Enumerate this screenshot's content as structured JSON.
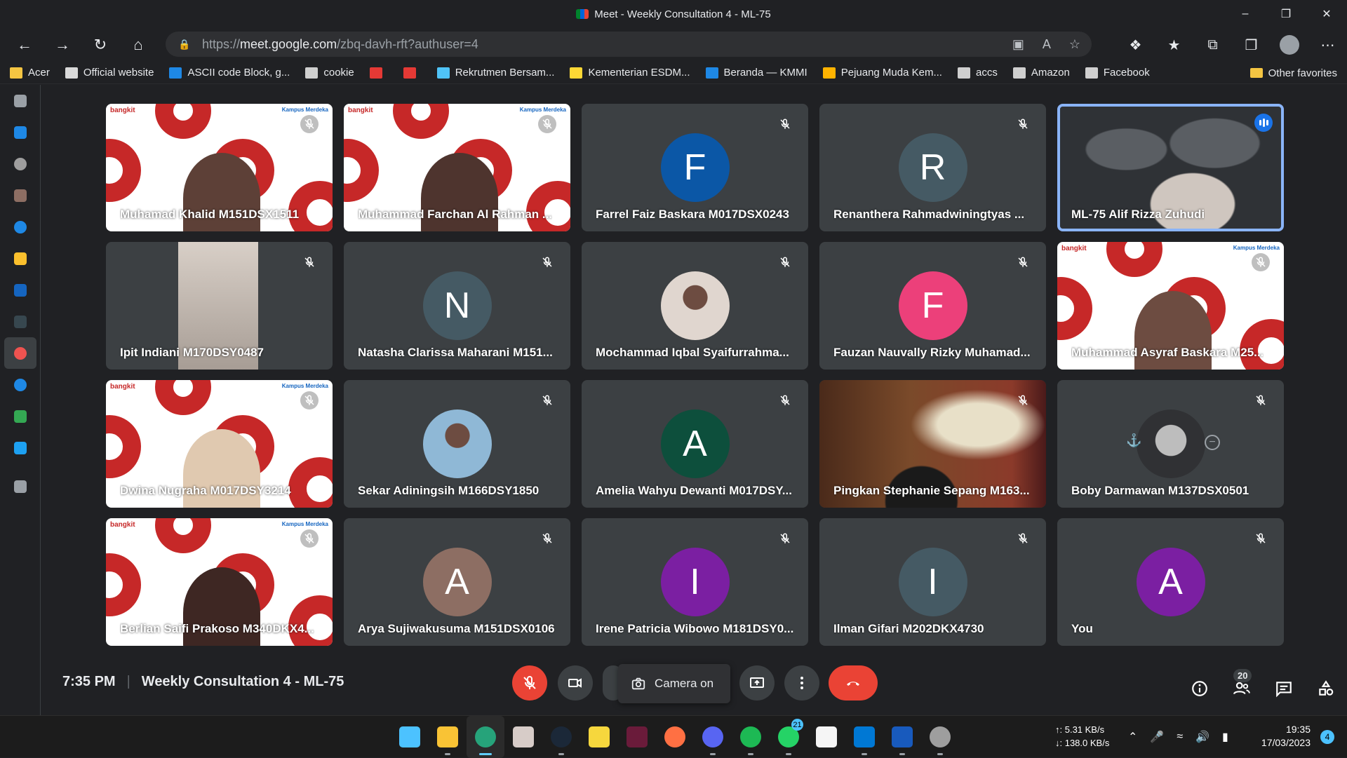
{
  "window": {
    "title": "Meet - Weekly Consultation 4 - ML-75"
  },
  "browser": {
    "url_prefix": "https://",
    "url_host": "meet.google.com",
    "url_path": "/zbq-davh-rft?authuser=4"
  },
  "favorites": [
    {
      "label": "Acer",
      "color": "#f4c542"
    },
    {
      "label": "Official website",
      "color": "#d9d9d9"
    },
    {
      "label": "ASCII code Block, g...",
      "color": "#1e88e5"
    },
    {
      "label": "cookie",
      "color": "#cfcfcf"
    },
    {
      "label": "",
      "color": "#e53935"
    },
    {
      "label": "",
      "color": "#e53935"
    },
    {
      "label": "Rekrutmen Bersam...",
      "color": "#4fc3f7"
    },
    {
      "label": "Kementerian ESDM...",
      "color": "#fdd835"
    },
    {
      "label": "Beranda — KMMI",
      "color": "#1e88e5"
    },
    {
      "label": "Pejuang Muda Kem...",
      "color": "#ffb300"
    },
    {
      "label": "accs",
      "color": "#cfcfcf"
    },
    {
      "label": "Amazon",
      "color": "#cfcfcf"
    },
    {
      "label": "Facebook",
      "color": "#cfcfcf"
    }
  ],
  "favorites_other": "Other favorites",
  "sidebar": [
    {
      "icon": "tabs-icon",
      "color": "#9aa0a6"
    },
    {
      "icon": "calendar-icon",
      "color": "#1e88e5"
    },
    {
      "icon": "chrome-icon",
      "color": "#9e9e9e"
    },
    {
      "icon": "image-app-icon",
      "color": "#8d6e63"
    },
    {
      "icon": "c-app-icon",
      "color": "#1e88e5"
    },
    {
      "icon": "emblem-icon",
      "color": "#fbc02d"
    },
    {
      "icon": "line-icon",
      "color": "#1565c0"
    },
    {
      "icon": "shield-app-icon",
      "color": "#37474f"
    },
    {
      "icon": "record-icon",
      "color": "#ef5350"
    },
    {
      "icon": "c-app-icon-2",
      "color": "#1e88e5"
    },
    {
      "icon": "drive-icon",
      "color": "#34a853"
    },
    {
      "icon": "twitter-icon",
      "color": "#1da1f2"
    },
    {
      "icon": "add-icon",
      "color": "#9aa0a6"
    }
  ],
  "participants": [
    {
      "name": "Muhamad Khalid M151DSX1511",
      "type": "bangkit",
      "skin": "#5d4037"
    },
    {
      "name": "Muhammad Farchan Al Rahman ...",
      "type": "bangkit",
      "skin": "#4e342e"
    },
    {
      "name": "Farrel Faiz Baskara M017DSX0243",
      "type": "letter",
      "letter": "F",
      "color": "#0b57a6"
    },
    {
      "name": "Renanthera Rahmadwiningtyas ...",
      "type": "letter",
      "letter": "R",
      "color": "#455a64"
    },
    {
      "name": "ML-75 Alif Rizza Zuhudi",
      "type": "worldmap",
      "speaking": true
    },
    {
      "name": "Ipit Indiani M170DSY0487",
      "type": "portrait"
    },
    {
      "name": "Natasha Clarissa Maharani M151...",
      "type": "letter",
      "letter": "N",
      "color": "#455a64"
    },
    {
      "name": "Mochammad Iqbal Syaifurrahma...",
      "type": "photo",
      "color": "#e0d6cf"
    },
    {
      "name": "Fauzan Nauvally Rizky Muhamad...",
      "type": "letter",
      "letter": "F",
      "color": "#ec407a"
    },
    {
      "name": "Muhammad Asyraf Baskara M25...",
      "type": "bangkit",
      "skin": "#6d4c41"
    },
    {
      "name": "Dwina Nugraha M017DSY3214",
      "type": "bangkit",
      "skin": "#e0c9b0"
    },
    {
      "name": "Sekar Adiningsih M166DSY1850",
      "type": "photo",
      "color": "#8fb8d6"
    },
    {
      "name": "Amelia Wahyu Dewanti M017DSY...",
      "type": "letter",
      "letter": "A",
      "color": "#0d4f3c"
    },
    {
      "name": "Pingkan Stephanie Sepang M163...",
      "type": "library"
    },
    {
      "name": "Boby Darmawan M137DSX0501",
      "type": "pinned"
    },
    {
      "name": "Berlian Saifi Prakoso M340DKX4...",
      "type": "bangkit",
      "skin": "#3e2723"
    },
    {
      "name": "Arya Sujiwakusuma M151DSX0106",
      "type": "letter",
      "letter": "A",
      "color": "#8d6e63"
    },
    {
      "name": "Irene Patricia Wibowo M181DSY0...",
      "type": "letter",
      "letter": "I",
      "color": "#7b1fa2"
    },
    {
      "name": "Ilman Gifari M202DKX4730",
      "type": "letter",
      "letter": "I",
      "color": "#455a64"
    },
    {
      "name": "You",
      "type": "letter",
      "letter": "A",
      "color": "#7b1fa2"
    }
  ],
  "meeting": {
    "time": "7:35 PM",
    "title": "Weekly Consultation 4 - ML-75",
    "camera_tooltip": "Camera on",
    "people_count": "20"
  },
  "taskbar": {
    "apps": [
      {
        "icon": "windows-start-icon",
        "color": "#4cc2ff",
        "active": false
      },
      {
        "icon": "file-explorer-icon",
        "color": "#f9c335",
        "active": false
      },
      {
        "icon": "edge-browser-icon",
        "color": "#26a37a",
        "active": true
      },
      {
        "icon": "photo-app-icon",
        "color": "#d7ccc8",
        "active": false
      },
      {
        "icon": "steam-icon",
        "color": "#1b2838",
        "active": false
      },
      {
        "icon": "sticky-notes-icon",
        "color": "#f6d73d",
        "active": false
      },
      {
        "icon": "media-app-icon",
        "color": "#6a1b3a",
        "active": false
      },
      {
        "icon": "search-app-icon",
        "color": "#ff7043",
        "active": false
      },
      {
        "icon": "discord-icon",
        "color": "#5865f2",
        "active": false
      },
      {
        "icon": "spotify-icon",
        "color": "#1db954",
        "active": false
      },
      {
        "icon": "whatsapp-icon",
        "color": "#25d366",
        "active": false,
        "badge": "21"
      },
      {
        "icon": "notion-icon",
        "color": "#f5f5f5",
        "active": false
      },
      {
        "icon": "vscode-icon",
        "color": "#0078d4",
        "active": false
      },
      {
        "icon": "word-icon",
        "color": "#185abd",
        "active": false
      },
      {
        "icon": "settings-icon",
        "color": "#9e9e9e",
        "active": false
      }
    ],
    "upload_speed": "↑: 5.31 KB/s",
    "download_speed": "↓: 138.0 KB/s",
    "time": "19:35",
    "date": "17/03/2023",
    "notifications": "4"
  }
}
